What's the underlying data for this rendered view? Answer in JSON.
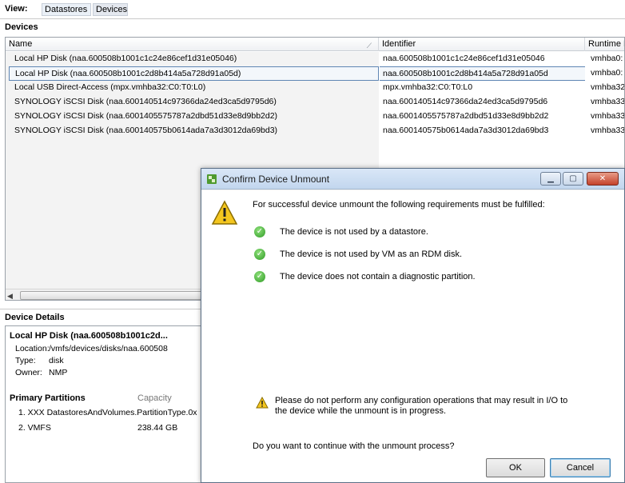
{
  "viewbar": {
    "label": "View:",
    "tabs": [
      "Datastores",
      "Devices"
    ]
  },
  "devices": {
    "section_title": "Devices",
    "columns": [
      "Name",
      "Identifier",
      "Runtime N"
    ],
    "rows": [
      {
        "name": "Local HP Disk (naa.600508b1001c1c24e86cef1d31e05046)",
        "identifier": "naa.600508b1001c1c24e86cef1d31e05046",
        "runtime": "vmhba0:"
      },
      {
        "name": "Local HP Disk (naa.600508b1001c2d8b414a5a728d91a05d)",
        "identifier": "naa.600508b1001c2d8b414a5a728d91a05d",
        "runtime": "vmhba0:"
      },
      {
        "name": "Local USB Direct-Access (mpx.vmhba32:C0:T0:L0)",
        "identifier": "mpx.vmhba32:C0:T0:L0",
        "runtime": "vmhba32"
      },
      {
        "name": "SYNOLOGY iSCSI Disk (naa.600140514c97366da24ed3ca5d9795d6)",
        "identifier": "naa.600140514c97366da24ed3ca5d9795d6",
        "runtime": "vmhba33"
      },
      {
        "name": "SYNOLOGY iSCSI Disk (naa.6001405575787a2dbd51d33e8d9bb2d2)",
        "identifier": "naa.6001405575787a2dbd51d33e8d9bb2d2",
        "runtime": "vmhba33"
      },
      {
        "name": "SYNOLOGY iSCSI Disk (naa.600140575b0614ada7a3d3012da69bd3)",
        "identifier": "naa.600140575b0614ada7a3d3012da69bd3",
        "runtime": "vmhba33"
      }
    ],
    "selected_index": 1
  },
  "details": {
    "section_title": "Device Details",
    "device_title": "Local HP Disk (naa.600508b1001c2d...",
    "location_label": "Location:",
    "location_value": "/vmfs/devices/disks/naa.600508",
    "type_label": "Type:",
    "type_value": "disk",
    "owner_label": "Owner:",
    "owner_value": "NMP",
    "partitions_title": "Primary Partitions",
    "capacity_label": "Capacity",
    "partitions": [
      {
        "name": "1. XXX DatastoresAndVolumes.PartitionType.0x",
        "capacity": ""
      },
      {
        "name": "2. VMFS",
        "capacity": "238.44 GB"
      }
    ]
  },
  "dialog": {
    "title": "Confirm Device Unmount",
    "intro": "For successful device unmount the following requirements must be fulfilled:",
    "requirements": [
      "The device is not used by a datastore.",
      "The device is not used by VM as an RDM disk.",
      "The device does not contain a diagnostic partition."
    ],
    "note": "Please do not perform any configuration operations that may result in I/O to the device while the unmount is in progress.",
    "question": "Do you want to continue with the unmount process?",
    "ok_label": "OK",
    "cancel_label": "Cancel"
  },
  "colors": {
    "selection_border": "#5f86b4",
    "titlebar": "#c2d6ee",
    "check_green": "#2f9b26",
    "warning_yellow": "#f4c61f"
  }
}
